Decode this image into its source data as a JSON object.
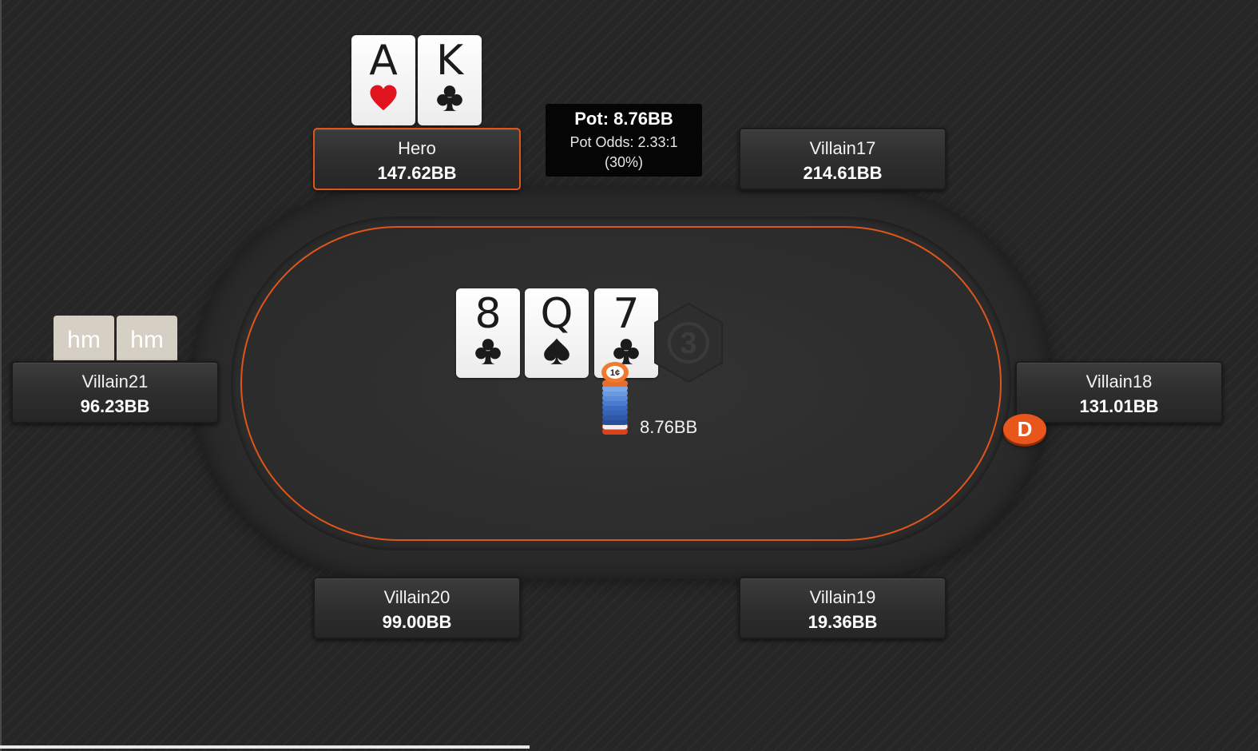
{
  "hero": {
    "name": "Hero",
    "stack": "147.62BB",
    "cards": [
      {
        "rank": "A",
        "suit": "hearts"
      },
      {
        "rank": "K",
        "suit": "clubs"
      }
    ]
  },
  "pot": {
    "title": "Pot: 8.76BB",
    "odds": "Pot Odds: 2.33:1",
    "percent": "(30%)"
  },
  "seats": {
    "villain17": {
      "name": "Villain17",
      "stack": "214.61BB"
    },
    "villain18": {
      "name": "Villain18",
      "stack": "131.01BB"
    },
    "villain19": {
      "name": "Villain19",
      "stack": "19.36BB"
    },
    "villain20": {
      "name": "Villain20",
      "stack": "99.00BB"
    },
    "villain21": {
      "name": "Villain21",
      "stack": "96.23BB",
      "hidden_cards": [
        "hm",
        "hm"
      ]
    }
  },
  "board": {
    "cards": [
      {
        "rank": "8",
        "suit": "clubs"
      },
      {
        "rank": "Q",
        "suit": "spades"
      },
      {
        "rank": "7",
        "suit": "clubs"
      }
    ],
    "street_badge": "3"
  },
  "bet": {
    "chip_label": "1¢",
    "amount": "8.76BB"
  },
  "dealer_button": {
    "label": "D",
    "seat": "Villain18"
  },
  "colors": {
    "accent": "#e0561a",
    "red_suit": "#e0141e",
    "black_suit": "#1b1b1b",
    "hidden_card": "#d6cfc3"
  },
  "icons": {
    "hearts": "heart-suit-icon",
    "clubs": "club-suit-icon",
    "spades": "spade-suit-icon"
  }
}
